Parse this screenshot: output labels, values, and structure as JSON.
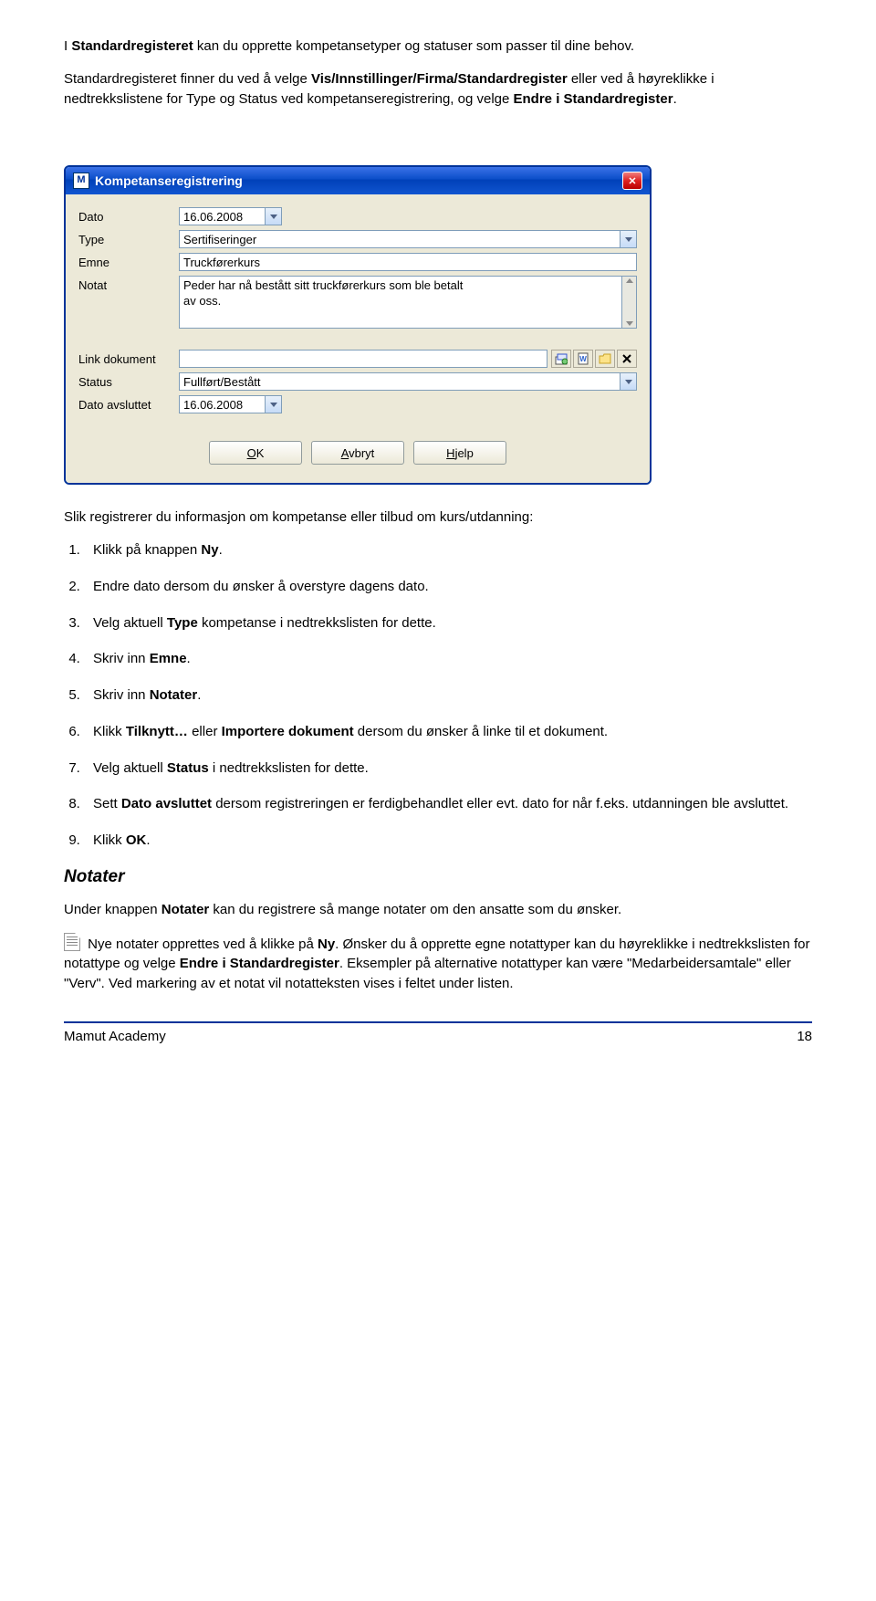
{
  "intro": {
    "p1_a": "I ",
    "p1_b": "Standardregisteret",
    "p1_c": " kan du opprette kompetansetyper og statuser som passer til dine behov.",
    "p2_a": "Standardregisteret finner du ved å velge ",
    "p2_b": "Vis/Innstillinger/Firma/Standardregister",
    "p2_c": " eller ved å høyreklikke i nedtrekkslistene for Type og Status ved kompetanseregistrering, og velge ",
    "p2_d": "Endre i Standardregister",
    "p2_e": "."
  },
  "dialog": {
    "title_icon": "M",
    "title": "Kompetanseregistrering",
    "labels": {
      "dato": "Dato",
      "type": "Type",
      "emne": "Emne",
      "notat": "Notat",
      "link": "Link dokument",
      "status": "Status",
      "dato_avsluttet": "Dato avsluttet"
    },
    "values": {
      "dato": "16.06.2008",
      "type": "Sertifiseringer",
      "emne": "Truckførerkurs",
      "notat_l1": "Peder har nå bestått sitt truckførerkurs som ble betalt",
      "notat_l2": "av oss.",
      "link": "",
      "status": "Fullført/Bestått",
      "dato_avsluttet": "16.06.2008"
    },
    "buttons": {
      "ok_u": "O",
      "ok_rest": "K",
      "avbryt_u": "A",
      "avbryt_rest": "vbryt",
      "hjelp_u": "H",
      "hjelp_rest": "jelp"
    }
  },
  "preSteps": "Slik registrerer du informasjon om kompetanse eller tilbud om kurs/utdanning:",
  "steps": {
    "s1_a": "Klikk på knappen ",
    "s1_b": "Ny",
    "s1_c": ".",
    "s2": "Endre dato dersom du ønsker å overstyre dagens dato.",
    "s3_a": "Velg aktuell ",
    "s3_b": "Type",
    "s3_c": " kompetanse i nedtrekkslisten for dette.",
    "s4_a": "Skriv inn ",
    "s4_b": "Emne",
    "s4_c": ".",
    "s5_a": "Skriv inn ",
    "s5_b": "Notater",
    "s5_c": ".",
    "s6_a": "Klikk ",
    "s6_b": "Tilknytt…",
    "s6_c": " eller ",
    "s6_d": "Importere dokument",
    "s6_e": " dersom du ønsker å linke til et dokument.",
    "s7_a": "Velg aktuell ",
    "s7_b": "Status",
    "s7_c": " i nedtrekkslisten for dette.",
    "s8_a": "Sett ",
    "s8_b": "Dato avsluttet",
    "s8_c": " dersom registreringen er ferdigbehandlet eller evt. dato for når f.eks. utdanningen ble avsluttet.",
    "s9_a": "Klikk ",
    "s9_b": "OK",
    "s9_c": "."
  },
  "notater": {
    "heading": "Notater",
    "p1_a": "Under knappen ",
    "p1_b": "Notater",
    "p1_c": " kan du registrere så mange notater om den ansatte som du ønsker.",
    "p2_a": " Nye notater opprettes ved å klikke på ",
    "p2_b": "Ny",
    "p2_c": ". Ønsker du å opprette egne notattyper kan du høyreklikke i nedtrekkslisten for notattype og velge ",
    "p2_d": "Endre i Standardregister",
    "p2_e": ". Eksempler på alternative notattyper kan være \"Medarbeidersamtale\" eller \"Verv\". Ved markering av et notat vil notatteksten vises i feltet under listen."
  },
  "footer": {
    "left": "Mamut Academy",
    "right": "18"
  }
}
